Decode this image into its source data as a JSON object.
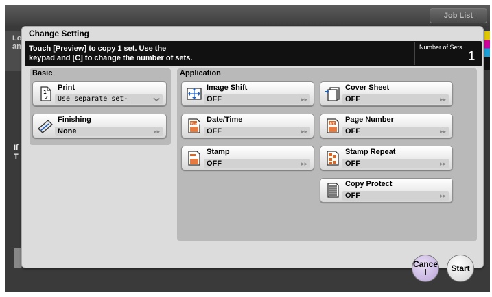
{
  "header": {
    "job_list_label": "Job List"
  },
  "background": {
    "left_text_1": "Lo\nan",
    "left_text_2": "If\nT"
  },
  "dialog": {
    "title": "Change Setting",
    "message": "Touch [Preview] to copy 1 set. Use the\nkeypad and [C] to change the number of sets.",
    "number_of_sets_label": "Number of Sets",
    "number_of_sets_value": "1"
  },
  "basic": {
    "label": "Basic",
    "print": {
      "title": "Print",
      "value": "Use separate set-",
      "icon": "print-document-icon"
    },
    "finishing": {
      "title": "Finishing",
      "value": "None",
      "icon": "finishing-icon"
    }
  },
  "application": {
    "label": "Application",
    "image_shift": {
      "title": "Image Shift",
      "value": "OFF",
      "icon": "image-shift-icon"
    },
    "date_time": {
      "title": "Date/Time",
      "value": "OFF",
      "icon": "date-time-icon"
    },
    "stamp": {
      "title": "Stamp",
      "value": "OFF",
      "icon": "stamp-icon"
    },
    "cover_sheet": {
      "title": "Cover Sheet",
      "value": "OFF",
      "icon": "cover-sheet-icon"
    },
    "page_number": {
      "title": "Page Number",
      "value": "OFF",
      "icon": "page-number-icon"
    },
    "stamp_repeat": {
      "title": "Stamp Repeat",
      "value": "OFF",
      "icon": "stamp-repeat-icon"
    },
    "copy_protect": {
      "title": "Copy Protect",
      "value": "OFF",
      "icon": "copy-protect-icon"
    }
  },
  "footer": {
    "cancel_label": "Cance\nl",
    "start_label": "Start"
  },
  "colors": {
    "message_bar": "#111111",
    "dialog_bg": "#dcdcdc",
    "group_bg": "#b9b9b9",
    "cancel_button": "#b9a4d8",
    "icon_orange": "#e0641e",
    "icon_blue": "#1a5fc8"
  }
}
